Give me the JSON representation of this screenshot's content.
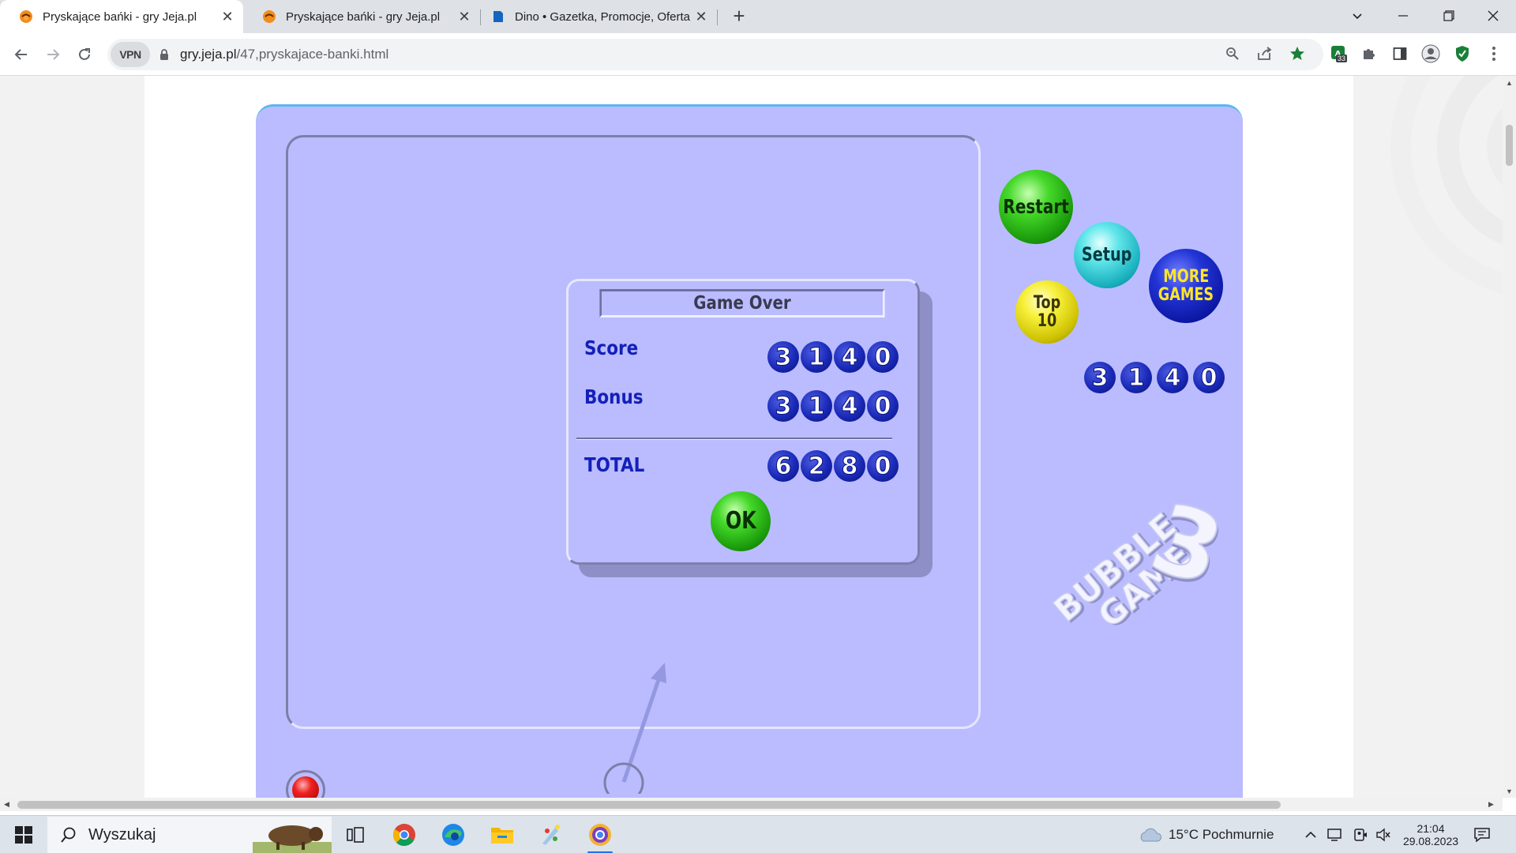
{
  "browser": {
    "tabs": [
      {
        "title": "Pryskające bańki - gry Jeja.pl",
        "active": true
      },
      {
        "title": "Pryskające bańki - gry Jeja.pl",
        "active": false
      },
      {
        "title": "Dino • Gazetka, Promocje, Oferta",
        "active": false
      }
    ],
    "new_tab_label": "+",
    "url_host": "gry.jeja.pl",
    "url_path": "/47,pryskajace-banki.html",
    "vpn_label": "VPN",
    "extension_badge": "33"
  },
  "game": {
    "dialog": {
      "title": "Game Over",
      "score_label": "Score",
      "score_digits": [
        "3",
        "1",
        "4",
        "0"
      ],
      "bonus_label": "Bonus",
      "bonus_digits": [
        "3",
        "1",
        "4",
        "0"
      ],
      "total_label": "TOTAL",
      "total_digits": [
        "6",
        "2",
        "8",
        "0"
      ],
      "ok_label": "OK"
    },
    "buttons": {
      "restart": "Restart",
      "setup": "Setup",
      "top10": "Top 10",
      "more_games_line1": "MORE",
      "more_games_line2": "GAMES"
    },
    "score_digits": [
      "3",
      "1",
      "4",
      "0"
    ],
    "logo": {
      "line1": "BUBBLE",
      "line2": "GAME",
      "number": "3"
    }
  },
  "taskbar": {
    "search_placeholder": "Wyszukaj",
    "weather": "15°C  Pochmurnie",
    "time": "21:04",
    "date": "29.08.2023"
  }
}
